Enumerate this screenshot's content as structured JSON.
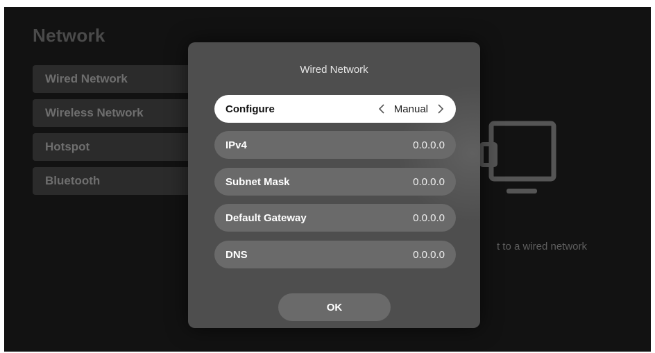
{
  "background": {
    "title": "Network",
    "menu": [
      {
        "label": "Wired Network"
      },
      {
        "label": "Wireless Network"
      },
      {
        "label": "Hotspot"
      },
      {
        "label": "Bluetooth"
      }
    ],
    "hint": "t to a wired network"
  },
  "dialog": {
    "title": "Wired Network",
    "configure": {
      "label": "Configure",
      "value": "Manual"
    },
    "fields": [
      {
        "label": "IPv4",
        "value": "0.0.0.0"
      },
      {
        "label": "Subnet Mask",
        "value": "0.0.0.0"
      },
      {
        "label": "Default Gateway",
        "value": "0.0.0.0"
      },
      {
        "label": "DNS",
        "value": "0.0.0.0"
      }
    ],
    "ok_label": "OK"
  },
  "icons": {
    "chevron_left": "chevron-left-icon",
    "chevron_right": "chevron-right-icon",
    "device": "tv-device-icon"
  },
  "colors": {
    "screen_bg": "#121212",
    "dialog_bg": "#4e4e4e",
    "row_bg": "#6a6a6a",
    "focused_row_bg": "#ffffff"
  }
}
